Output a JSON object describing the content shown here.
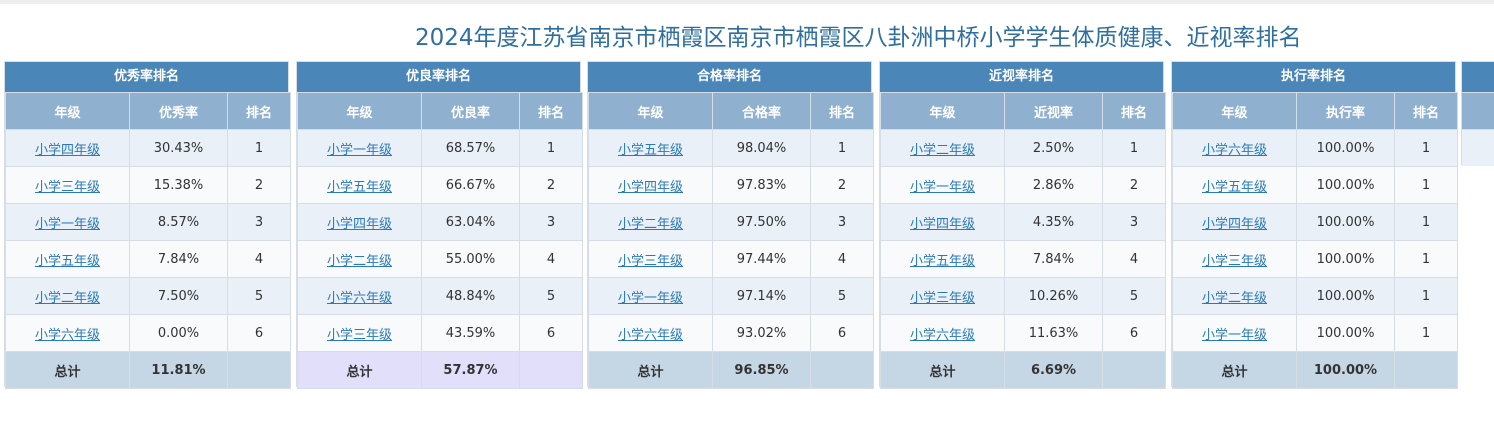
{
  "page": {
    "title": "2024年度江苏省南京市栖霞区南京市栖霞区八卦洲中桥小学学生体质健康、近视率排名"
  },
  "panels": [
    {
      "title": "优秀率排名",
      "headers": [
        "年级",
        "优秀率",
        "排名"
      ],
      "rows": [
        [
          "小学四年级",
          "30.43%",
          "1"
        ],
        [
          "小学三年级",
          "15.38%",
          "2"
        ],
        [
          "小学一年级",
          "8.57%",
          "3"
        ],
        [
          "小学五年级",
          "7.84%",
          "4"
        ],
        [
          "小学二年级",
          "7.50%",
          "5"
        ],
        [
          "小学六年级",
          "0.00%",
          "6"
        ]
      ],
      "total": [
        "总计",
        "11.81%",
        ""
      ]
    },
    {
      "title": "优良率排名",
      "headers": [
        "年级",
        "优良率",
        "排名"
      ],
      "rows": [
        [
          "小学一年级",
          "68.57%",
          "1"
        ],
        [
          "小学五年级",
          "66.67%",
          "2"
        ],
        [
          "小学四年级",
          "63.04%",
          "3"
        ],
        [
          "小学二年级",
          "55.00%",
          "4"
        ],
        [
          "小学六年级",
          "48.84%",
          "5"
        ],
        [
          "小学三年级",
          "43.59%",
          "6"
        ]
      ],
      "total": [
        "总计",
        "57.87%",
        ""
      ]
    },
    {
      "title": "合格率排名",
      "headers": [
        "年级",
        "合格率",
        "排名"
      ],
      "rows": [
        [
          "小学五年级",
          "98.04%",
          "1"
        ],
        [
          "小学四年级",
          "97.83%",
          "2"
        ],
        [
          "小学二年级",
          "97.50%",
          "3"
        ],
        [
          "小学三年级",
          "97.44%",
          "4"
        ],
        [
          "小学一年级",
          "97.14%",
          "5"
        ],
        [
          "小学六年级",
          "93.02%",
          "6"
        ]
      ],
      "total": [
        "总计",
        "96.85%",
        ""
      ]
    },
    {
      "title": "近视率排名",
      "headers": [
        "年级",
        "近视率",
        "排名"
      ],
      "rows": [
        [
          "小学二年级",
          "2.50%",
          "1"
        ],
        [
          "小学一年级",
          "2.86%",
          "2"
        ],
        [
          "小学四年级",
          "4.35%",
          "3"
        ],
        [
          "小学五年级",
          "7.84%",
          "4"
        ],
        [
          "小学三年级",
          "10.26%",
          "5"
        ],
        [
          "小学六年级",
          "11.63%",
          "6"
        ]
      ],
      "total": [
        "总计",
        "6.69%",
        ""
      ]
    },
    {
      "title": "执行率排名",
      "headers": [
        "年级",
        "执行率",
        "排名"
      ],
      "rows": [
        [
          "小学六年级",
          "100.00%",
          "1"
        ],
        [
          "小学五年级",
          "100.00%",
          "1"
        ],
        [
          "小学四年级",
          "100.00%",
          "1"
        ],
        [
          "小学三年级",
          "100.00%",
          "1"
        ],
        [
          "小学二年级",
          "100.00%",
          "1"
        ],
        [
          "小学一年级",
          "100.00%",
          "1"
        ]
      ],
      "total": [
        "总计",
        "100.00%",
        ""
      ]
    }
  ],
  "colors": {
    "title_text": "#2f6f9f",
    "panel_header": "#4a86b8",
    "column_header": "#8fb0cf",
    "row_odd": "#e9f0f8",
    "row_even": "#f8fafc",
    "total_row": "#c5d6e5",
    "total_row_alt": "#e2dffb",
    "link": "#2a7ab8"
  }
}
